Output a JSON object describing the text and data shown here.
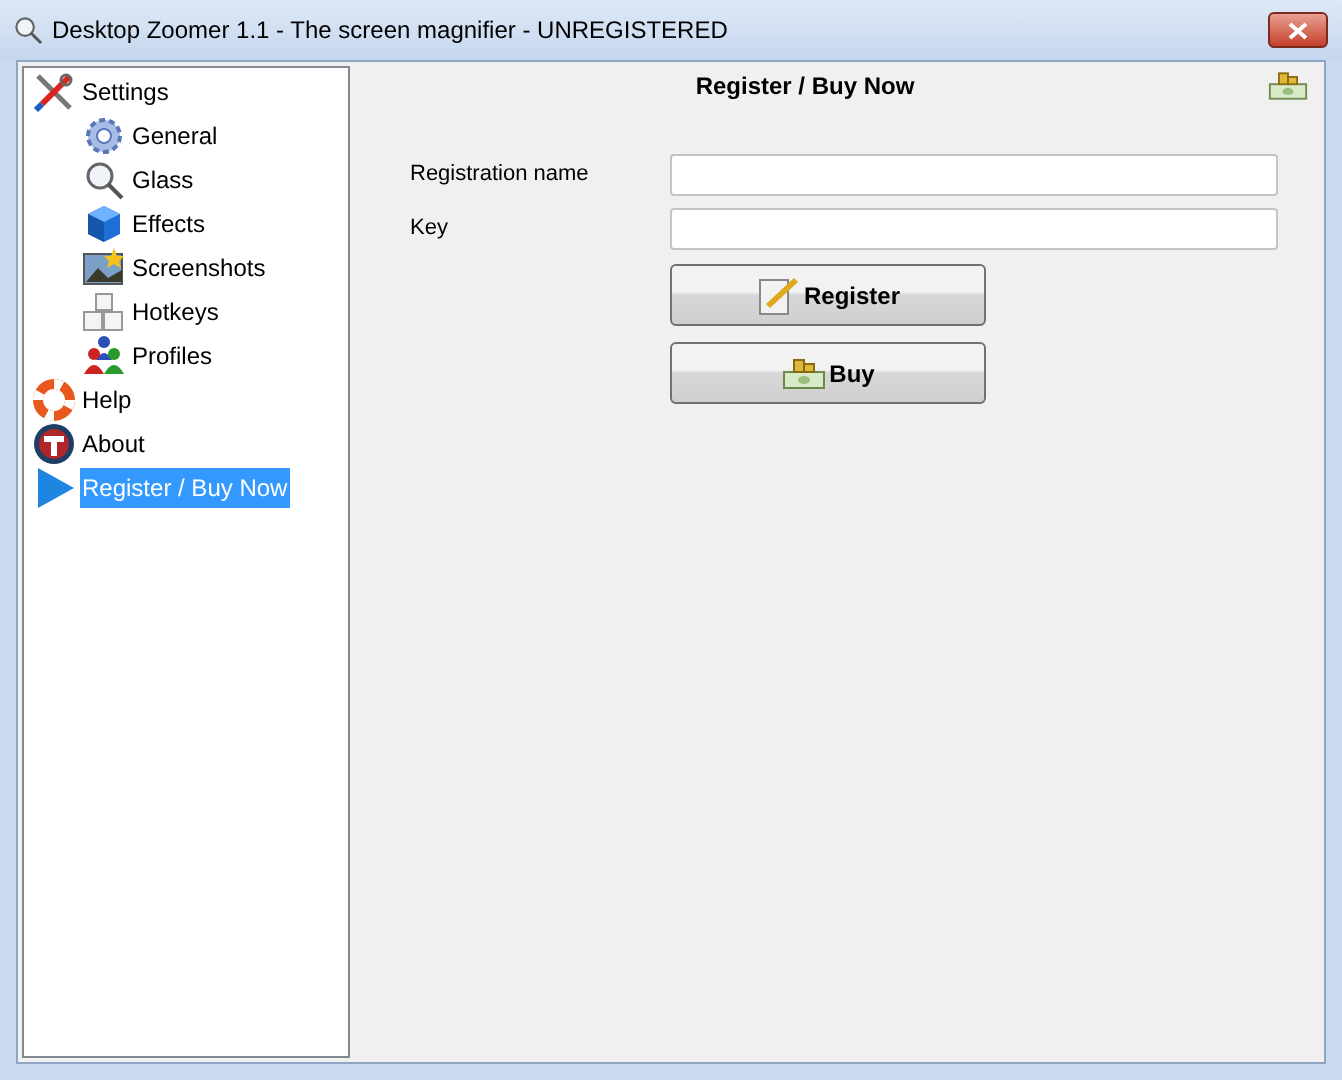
{
  "window": {
    "title": "Desktop Zoomer 1.1 - The screen magnifier - UNREGISTERED"
  },
  "tree": [
    {
      "label": "Settings",
      "kind": "tools",
      "selected": false,
      "children": [
        {
          "label": "General",
          "kind": "gear",
          "selected": false
        },
        {
          "label": "Glass",
          "kind": "magnifier",
          "selected": false
        },
        {
          "label": "Effects",
          "kind": "cube",
          "selected": false
        },
        {
          "label": "Screenshots",
          "kind": "photo",
          "selected": false
        },
        {
          "label": "Hotkeys",
          "kind": "keys",
          "selected": false
        },
        {
          "label": "Profiles",
          "kind": "people",
          "selected": false
        }
      ]
    },
    {
      "label": "Help",
      "kind": "lifebuoy",
      "selected": false
    },
    {
      "label": "About",
      "kind": "about",
      "selected": false
    },
    {
      "label": "Register / Buy Now",
      "kind": "play",
      "selected": true
    }
  ],
  "panel": {
    "title": "Register / Buy Now",
    "fields": [
      {
        "label": "Registration name"
      },
      {
        "label": "Key"
      }
    ],
    "buttons": [
      {
        "label": "Register",
        "kind": "pen"
      },
      {
        "label": "Buy",
        "kind": "money"
      }
    ]
  }
}
